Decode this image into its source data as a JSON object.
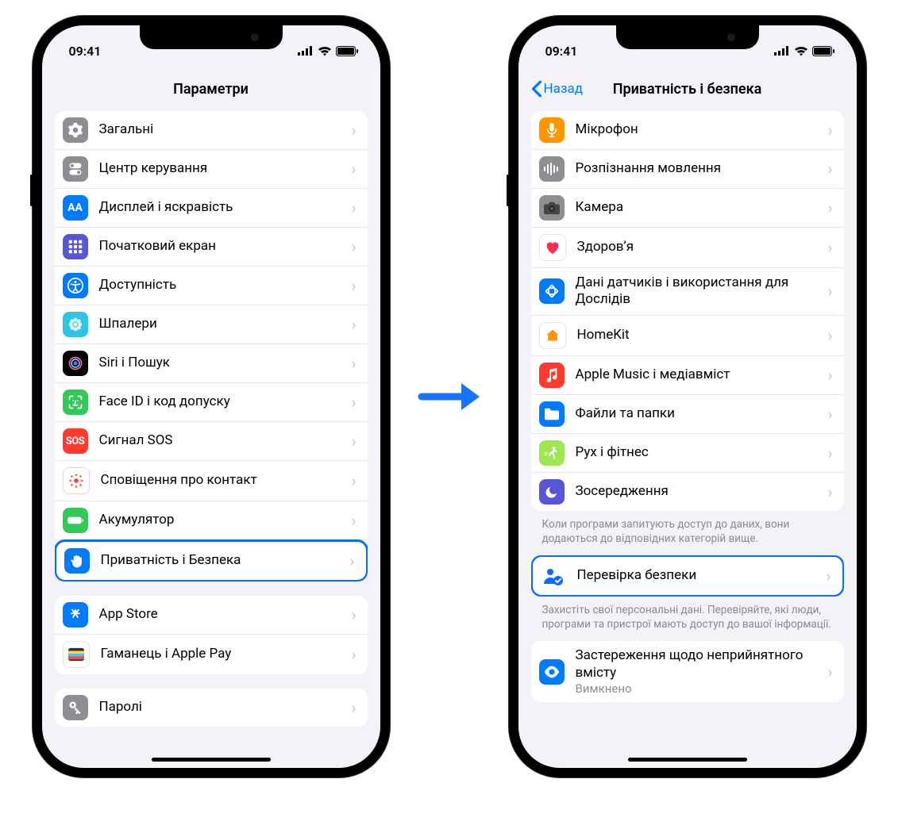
{
  "status": {
    "time": "09:41"
  },
  "phone1": {
    "title": "Параметри",
    "groups": [
      {
        "rows": [
          {
            "id": "general",
            "label": "Загальні"
          },
          {
            "id": "control-center",
            "label": "Центр керування"
          },
          {
            "id": "display",
            "label": "Дисплей і яскравість"
          },
          {
            "id": "home-screen",
            "label": "Початковий екран"
          },
          {
            "id": "accessibility",
            "label": "Доступність"
          },
          {
            "id": "wallpaper",
            "label": "Шпалери"
          },
          {
            "id": "siri",
            "label": "Siri і Пошук"
          },
          {
            "id": "faceid",
            "label": "Face ID і код допуску"
          },
          {
            "id": "sos",
            "label": "Сигнал SOS"
          },
          {
            "id": "exposure",
            "label": "Сповіщення про контакт"
          },
          {
            "id": "battery",
            "label": "Акумулятор"
          },
          {
            "id": "privacy",
            "label": "Приватність і Безпека",
            "highlight": true
          }
        ]
      },
      {
        "rows": [
          {
            "id": "appstore",
            "label": "App Store"
          },
          {
            "id": "wallet",
            "label": "Гаманець і Apple Pay"
          }
        ]
      },
      {
        "rows": [
          {
            "id": "passwords",
            "label": "Паролі"
          }
        ]
      }
    ]
  },
  "phone2": {
    "back": "Назад",
    "title": "Приватність і безпека",
    "groups": [
      {
        "rows": [
          {
            "id": "microphone",
            "label": "Мікрофон"
          },
          {
            "id": "speech",
            "label": "Розпізнання мовлення"
          },
          {
            "id": "camera",
            "label": "Камера"
          },
          {
            "id": "health",
            "label": "Здоров’я"
          },
          {
            "id": "research",
            "label": "Дані датчиків і використання для Дослідів"
          },
          {
            "id": "homekit",
            "label": "HomeKit"
          },
          {
            "id": "media",
            "label": "Apple Music і медіавміст"
          },
          {
            "id": "files",
            "label": "Файли та папки"
          },
          {
            "id": "motion",
            "label": "Рух і фітнес"
          },
          {
            "id": "focus",
            "label": "Зосередження"
          }
        ],
        "footer": "Коли програми запитують доступ до даних, вони додаються до відповідних категорій вище."
      },
      {
        "rows": [
          {
            "id": "safety-check",
            "label": "Перевірка безпеки",
            "highlight": true
          }
        ],
        "footer": "Захистіть свої персональні дані. Перевіряйте, які люди, програми та пристрої мають доступ до вашої інформації."
      },
      {
        "rows": [
          {
            "id": "sensitive",
            "label": "Застереження щодо неприйнятного вмісту",
            "sub": "Вимкнено"
          }
        ]
      }
    ]
  }
}
